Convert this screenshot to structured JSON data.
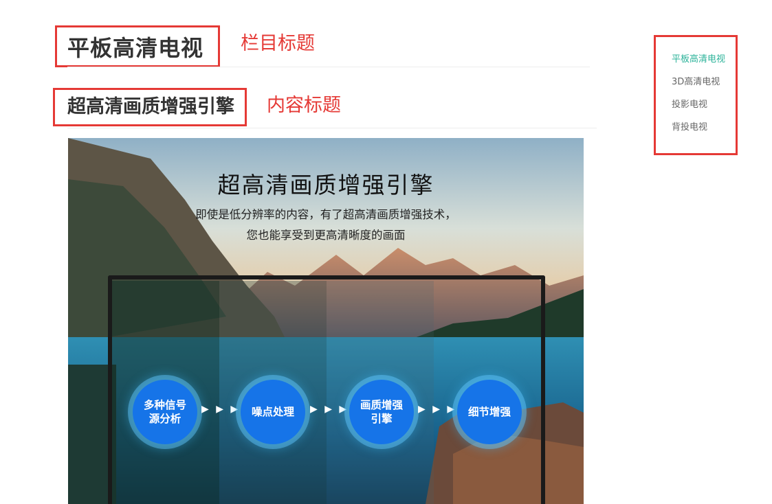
{
  "column": {
    "title": "平板高清电视",
    "annotation": "栏目标题"
  },
  "content": {
    "title": "超高清画质增强引擎",
    "annotation": "内容标题"
  },
  "banner": {
    "headline": "超高清画质增强引擎",
    "subtitle_line1": "即使是低分辨率的内容，有了超高清画质增强技术，",
    "subtitle_line2": "您也能享受到更高清晰度的画面",
    "steps": [
      {
        "line1": "多种信号",
        "line2": "源分析"
      },
      {
        "line1": "噪点处理",
        "line2": ""
      },
      {
        "line1": "画质增强",
        "line2": "引擎"
      },
      {
        "line1": "细节增强",
        "line2": ""
      }
    ],
    "arrow_glyph": "▶ ▶ ▶"
  },
  "nav": {
    "items": [
      {
        "label": "平板高清电视",
        "active": true
      },
      {
        "label": "3D高清电视",
        "active": false
      },
      {
        "label": "投影电视",
        "active": false
      },
      {
        "label": "背投电视",
        "active": false
      }
    ]
  },
  "colors": {
    "annotation_red": "#e53935",
    "nav_active": "#2cb39a",
    "step_blue": "#1674e8"
  }
}
